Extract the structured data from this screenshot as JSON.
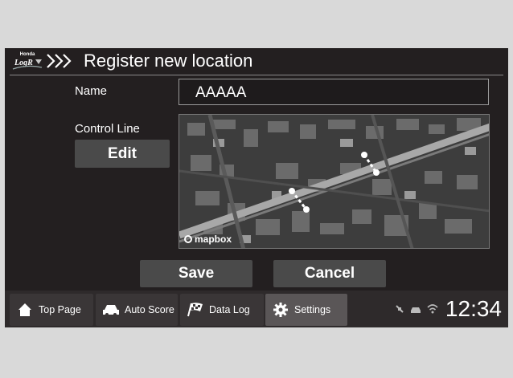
{
  "header": {
    "brand": "Honda",
    "logo_mark": "LogR",
    "title": "Register new location"
  },
  "form": {
    "name_label": "Name",
    "name_value": "AAAAA",
    "control_line_label": "Control Line",
    "edit_label": "Edit",
    "map_attribution": "mapbox"
  },
  "actions": {
    "save_label": "Save",
    "cancel_label": "Cancel"
  },
  "nav": {
    "tabs": [
      {
        "label": "Top Page",
        "icon": "home-icon"
      },
      {
        "label": "Auto Score",
        "icon": "car-icon"
      },
      {
        "label": "Data Log",
        "icon": "checkered-flag-icon"
      },
      {
        "label": "Settings",
        "icon": "gear-icon",
        "active": true
      }
    ]
  },
  "status": {
    "time": "12:34"
  },
  "colors": {
    "background": "#231f20",
    "button": "#4a4a4a",
    "frame": "#d9d9d9"
  }
}
